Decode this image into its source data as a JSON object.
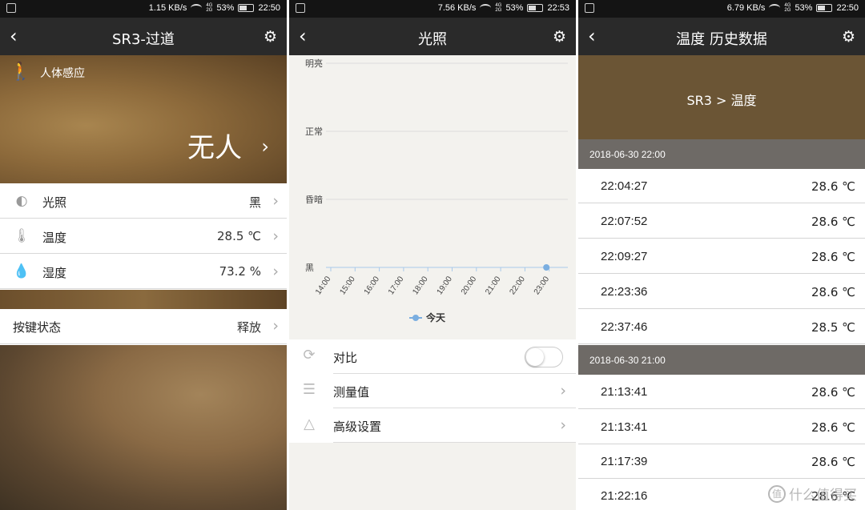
{
  "panel1": {
    "status": {
      "speed": "1.15 KB/s",
      "battery": "53%",
      "time": "22:50"
    },
    "title": "SR3-过道",
    "motion": {
      "label": "人体感应",
      "state": "无人"
    },
    "rows": [
      {
        "label": "光照",
        "value": "黑"
      },
      {
        "label": "温度",
        "value": "28.5 ℃"
      },
      {
        "label": "湿度",
        "value": "73.2 %"
      }
    ],
    "key_state": {
      "label": "按键状态",
      "value": "释放"
    }
  },
  "panel2": {
    "status": {
      "speed": "7.56 KB/s",
      "battery": "53%",
      "time": "22:53"
    },
    "title": "光照",
    "chart_data": {
      "type": "line",
      "y_categories": [
        "明亮",
        "正常",
        "昏暗",
        "黑"
      ],
      "x": [
        "14:00",
        "15:00",
        "16:00",
        "17:00",
        "18:00",
        "19:00",
        "20:00",
        "21:00",
        "22:00",
        "23:00"
      ],
      "series": [
        {
          "name": "今天",
          "points": [
            {
              "x": "22:53",
              "y": "黑"
            }
          ]
        }
      ],
      "color": "#7aaee0"
    },
    "options": [
      {
        "label": "对比"
      },
      {
        "label": "测量值"
      },
      {
        "label": "高级设置"
      }
    ]
  },
  "panel3": {
    "status": {
      "speed": "6.79 KB/s",
      "battery": "53%",
      "time": "22:50"
    },
    "title": "温度 历史数据",
    "breadcrumb": "SR3 > 温度",
    "groups": [
      {
        "header": "2018-06-30 22:00",
        "records": [
          {
            "time": "22:04:27",
            "value": "28.6 ℃"
          },
          {
            "time": "22:07:52",
            "value": "28.6 ℃"
          },
          {
            "time": "22:09:27",
            "value": "28.6 ℃"
          },
          {
            "time": "22:23:36",
            "value": "28.6 ℃"
          },
          {
            "time": "22:37:46",
            "value": "28.5 ℃"
          }
        ]
      },
      {
        "header": "2018-06-30 21:00",
        "records": [
          {
            "time": "21:13:41",
            "value": "28.6 ℃"
          },
          {
            "time": "21:13:41",
            "value": "28.6 ℃"
          },
          {
            "time": "21:17:39",
            "value": "28.6 ℃"
          },
          {
            "time": "21:22:16",
            "value": "28.6 ℃"
          }
        ]
      }
    ],
    "watermark": "什么值得买"
  }
}
